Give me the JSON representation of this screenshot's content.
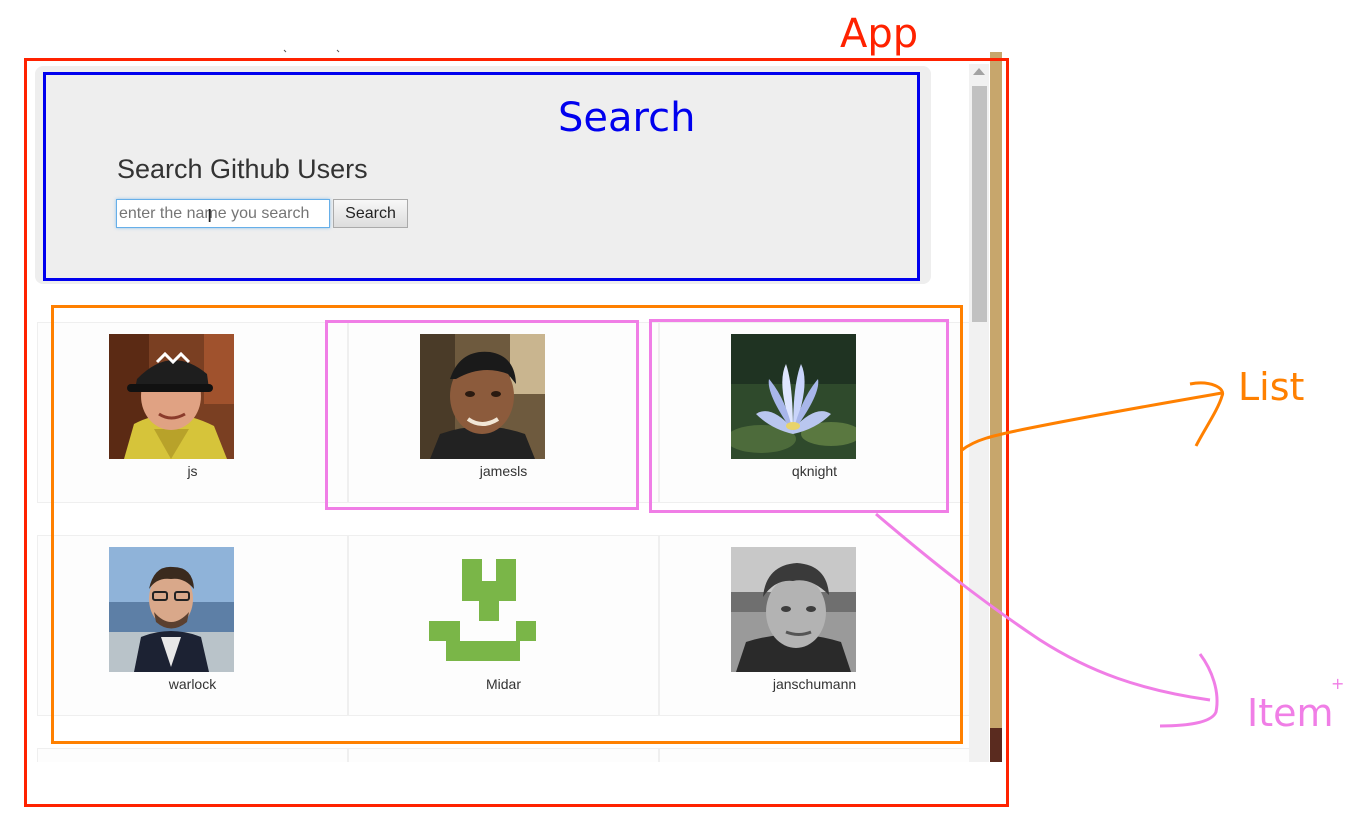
{
  "search": {
    "title": "Search Github Users",
    "placeholder": "enter the name you search",
    "button_label": "Search"
  },
  "users": [
    {
      "login": "js",
      "avatar": "photo-man-cap"
    },
    {
      "login": "jamesls",
      "avatar": "photo-man-portrait"
    },
    {
      "login": "qknight",
      "avatar": "photo-lotus-flower"
    },
    {
      "login": "warlock",
      "avatar": "photo-man-suit"
    },
    {
      "login": "Midar",
      "avatar": "identicon-green"
    },
    {
      "login": "janschumann",
      "avatar": "photo-man-bw"
    }
  ],
  "annotations": {
    "app": {
      "label": "App",
      "color": "#ff2200"
    },
    "search": {
      "label": "Search",
      "color": "#0000ee"
    },
    "list": {
      "label": "List",
      "color": "#ff8000"
    },
    "item": {
      "label": "Item",
      "color": "#f07ee6"
    },
    "plus_mark": "+"
  }
}
